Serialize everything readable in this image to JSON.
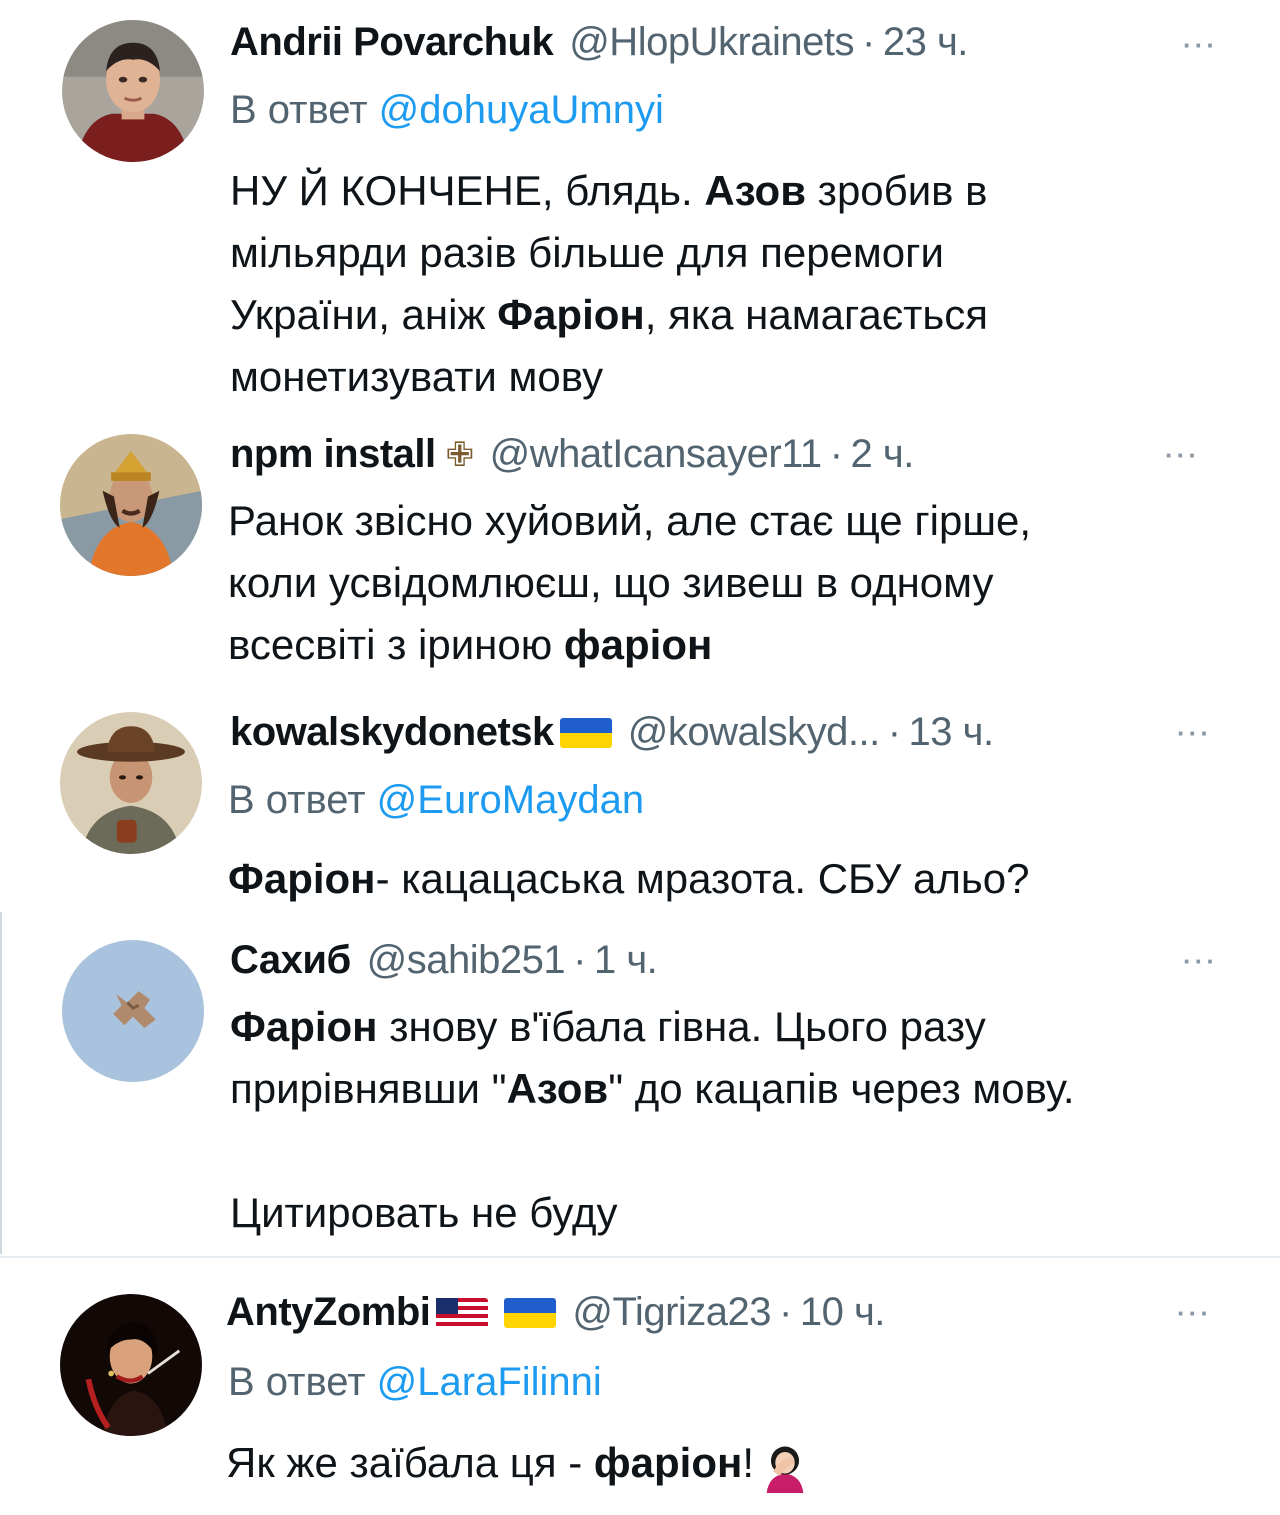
{
  "tweets": [
    {
      "name": "Andrii Povarchuk",
      "handle": "@HlopUkrainets",
      "time": "23 ч.",
      "reply_prefix": "В ответ",
      "reply_to": "@dohuyaUmnyi",
      "lines": [
        [
          "НУ Й КОНЧЕНЕ, блядь. ",
          "Азов",
          " зробив в"
        ],
        [
          "мільярди разів більше для перемоги"
        ],
        [
          "України, аніж ",
          "Фаріон",
          ", яка намагається"
        ],
        [
          "монетизувати мову"
        ]
      ]
    },
    {
      "name": "npm install",
      "handle": "@whatIcansayer11",
      "time": "2 ч.",
      "lines": [
        [
          "Ранок звісно хуйовий, але стає ще гірше,"
        ],
        [
          "коли усвідомлюєш, що зивеш в одному"
        ],
        [
          "всесвіті з іриною ",
          "фаріон"
        ]
      ]
    },
    {
      "name": "kowalskydonetsk",
      "handle": "@kowalskyd...",
      "time": "13 ч.",
      "reply_prefix": "В ответ",
      "reply_to": "@EuroMaydan",
      "lines": [
        [
          "Фаріон",
          "- кацацаська мразота. СБУ альо?"
        ]
      ]
    },
    {
      "name": "Сахиб",
      "handle": "@sahib251",
      "time": "1 ч.",
      "lines": [
        [
          "Фаріон",
          " знову в'їбала гівна. Цього разу"
        ],
        [
          "прирівнявши \"",
          "Азов",
          "\" до кацапів через мову."
        ],
        [
          ""
        ],
        [
          "Цитировать не буду"
        ]
      ]
    },
    {
      "name": "AntyZombi",
      "handle": "@Tigriza23",
      "time": "10 ч.",
      "reply_prefix": "В ответ",
      "reply_to": "@LaraFilinni",
      "lines": [
        [
          "Як же заїбала ця - ",
          "фаріон",
          "!"
        ]
      ]
    }
  ],
  "more_glyph": "···",
  "dot_glyph": "·",
  "icons": {
    "cross": "✙",
    "flag_ua": "flag-ukraine-icon",
    "flag_us": "flag-usa-icon",
    "emoji": "facepalm-woman-icon"
  },
  "colors": {
    "text": "#0f1419",
    "secondary": "#536471",
    "link": "#1d9bf0"
  }
}
